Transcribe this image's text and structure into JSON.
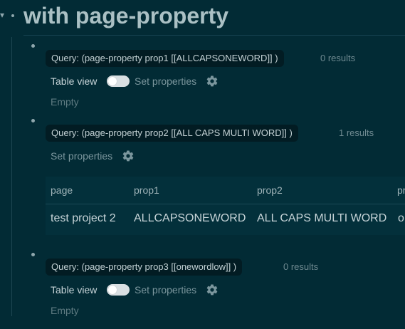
{
  "page": {
    "title": "with page-property"
  },
  "blocks": [
    {
      "query_text": "Query: (page-property prop1 [[ALLCAPSONEWORD]] )",
      "results": "0 results",
      "table_view_label": "Table view",
      "set_properties_label": "Set properties",
      "empty_text": "Empty"
    },
    {
      "query_text": "Query: (page-property prop2 [[ALL CAPS MULTI WORD]] )",
      "results": "1 results",
      "set_properties_label": "Set properties",
      "table": {
        "headers": [
          "page",
          "prop1",
          "prop2",
          "pr"
        ],
        "rows": [
          [
            "test project 2",
            "ALLCAPSONEWORD",
            "ALL CAPS MULTI WORD",
            "o"
          ]
        ]
      }
    },
    {
      "query_text": "Query: (page-property prop3 [[onewordlow]] )",
      "results": "0 results",
      "table_view_label": "Table view",
      "set_properties_label": "Set properties",
      "empty_text": "Empty"
    }
  ],
  "icons": {
    "collapse": "chevron-down-icon",
    "settings": "gear-icon"
  },
  "colors": {
    "background": "#022b35",
    "title": "#aac0c4",
    "chip_background": "#021c23",
    "muted_text": "#6f8a91",
    "toggle_off": "#d9dfe2"
  }
}
